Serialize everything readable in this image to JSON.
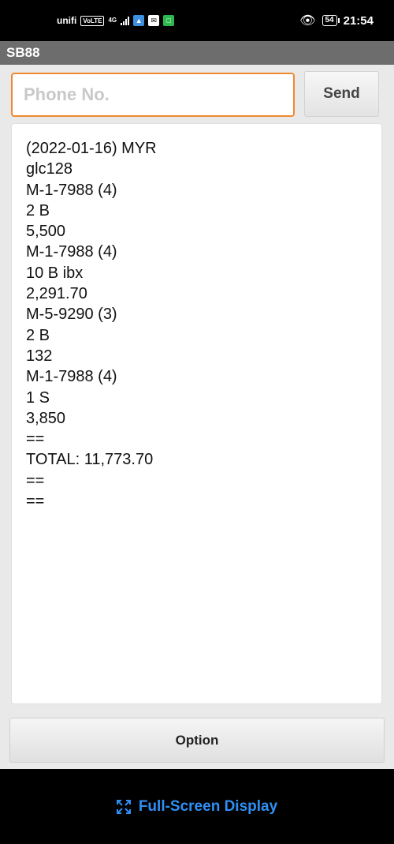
{
  "status": {
    "carrier": "unifi",
    "volte": "VoLTE",
    "network": "4G",
    "battery": "54",
    "time": "21:54"
  },
  "app": {
    "title": "SB88"
  },
  "compose": {
    "phone_placeholder": "Phone No.",
    "send_label": "Send"
  },
  "output": {
    "lines": [
      "(2022-01-16) MYR",
      "glc128",
      "M-1-7988 (4)",
      "2 B",
      "5,500",
      "M-1-7988 (4)",
      "10 B ibx",
      "2,291.70",
      "M-5-9290 (3)",
      "2 B",
      "132",
      "M-1-7988 (4)",
      "1 S",
      "3,850",
      "==",
      "TOTAL: 11,773.70",
      "==",
      "=="
    ]
  },
  "option_label": "Option",
  "bottom": {
    "fullscreen_label": "Full-Screen Display"
  },
  "colors": {
    "accent": "#f0892e",
    "link": "#2f8ff5"
  }
}
